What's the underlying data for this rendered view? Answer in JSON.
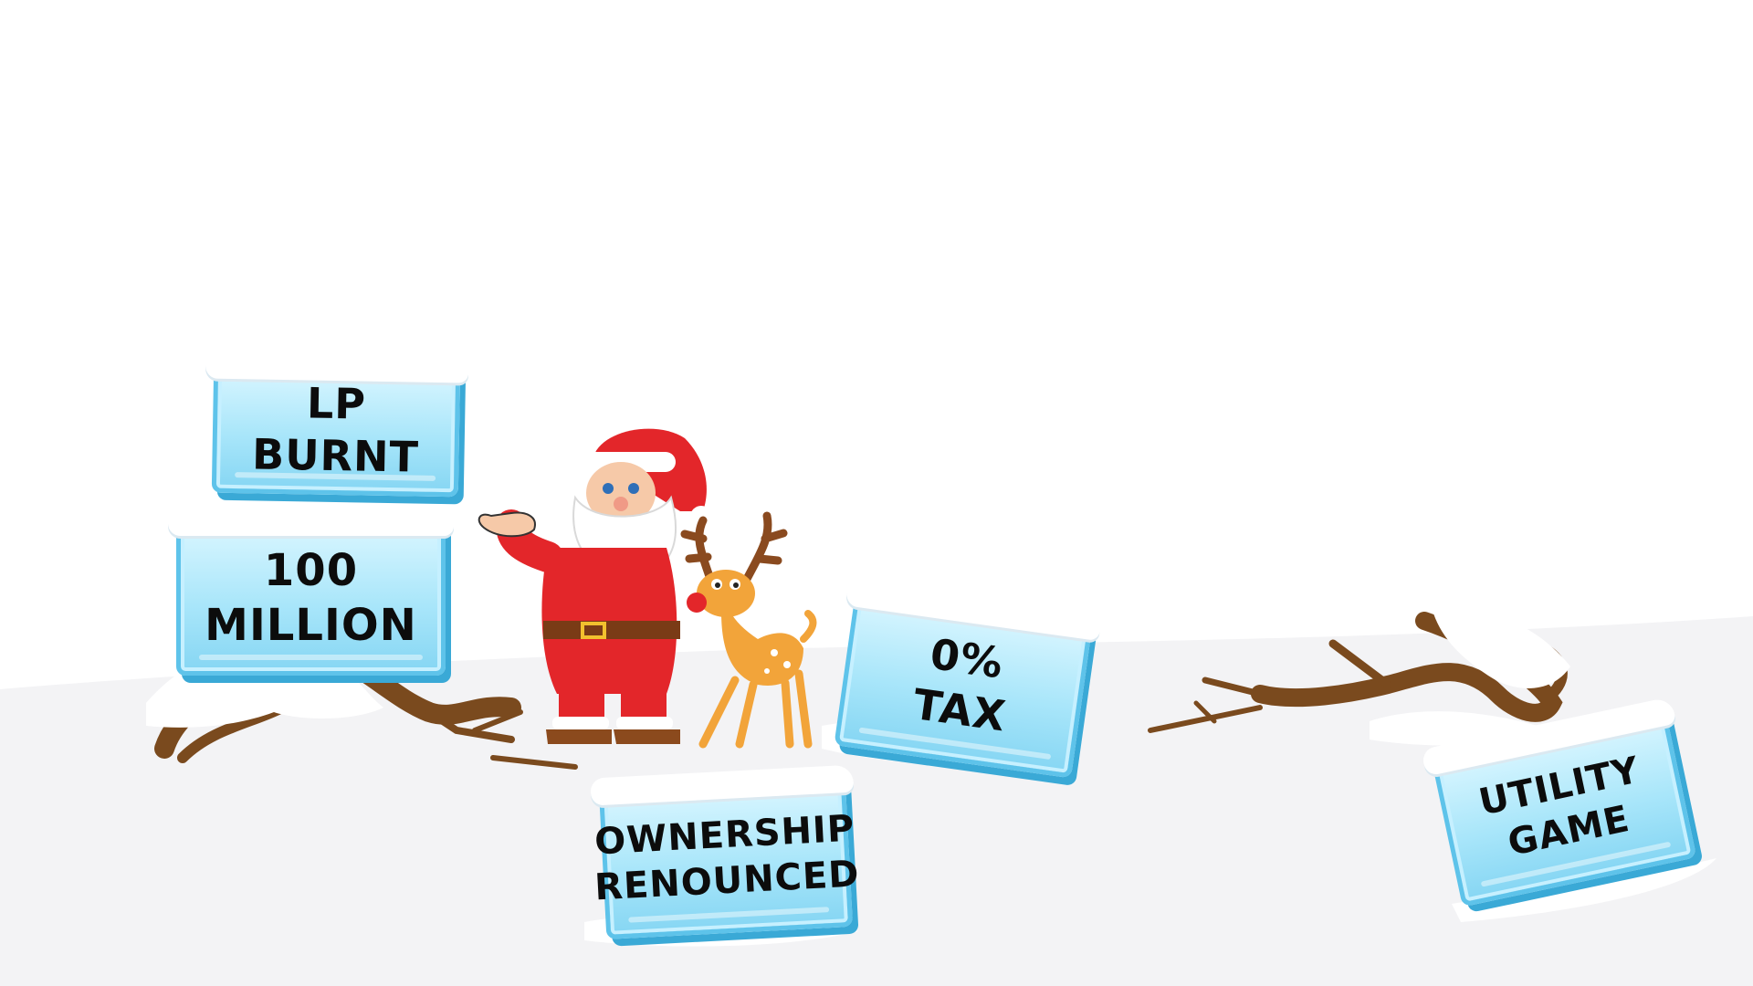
{
  "scene": {
    "colors": {
      "sky": "#ffffff",
      "snow": "#f3f3f5",
      "ice_light": "#d9f6ff",
      "ice_mid": "#a9e6fa",
      "ice_edge": "#5ec3ea",
      "branch": "#7a4a1e",
      "santa_red": "#e3262a",
      "reindeer": "#f2a43a"
    },
    "signs": {
      "lp_burnt": {
        "lines": [
          "LP BURNT"
        ]
      },
      "supply": {
        "lines": [
          "100 MILLION"
        ]
      },
      "tax": {
        "lines": [
          "0%",
          "TAX"
        ]
      },
      "ownership": {
        "lines": [
          "OWNERSHIP",
          "RENOUNCED"
        ]
      },
      "utility": {
        "lines": [
          "UTILITY",
          "GAME"
        ]
      }
    },
    "icons": [
      "santa-claus-icon",
      "reindeer-icon",
      "branch-icon"
    ]
  }
}
